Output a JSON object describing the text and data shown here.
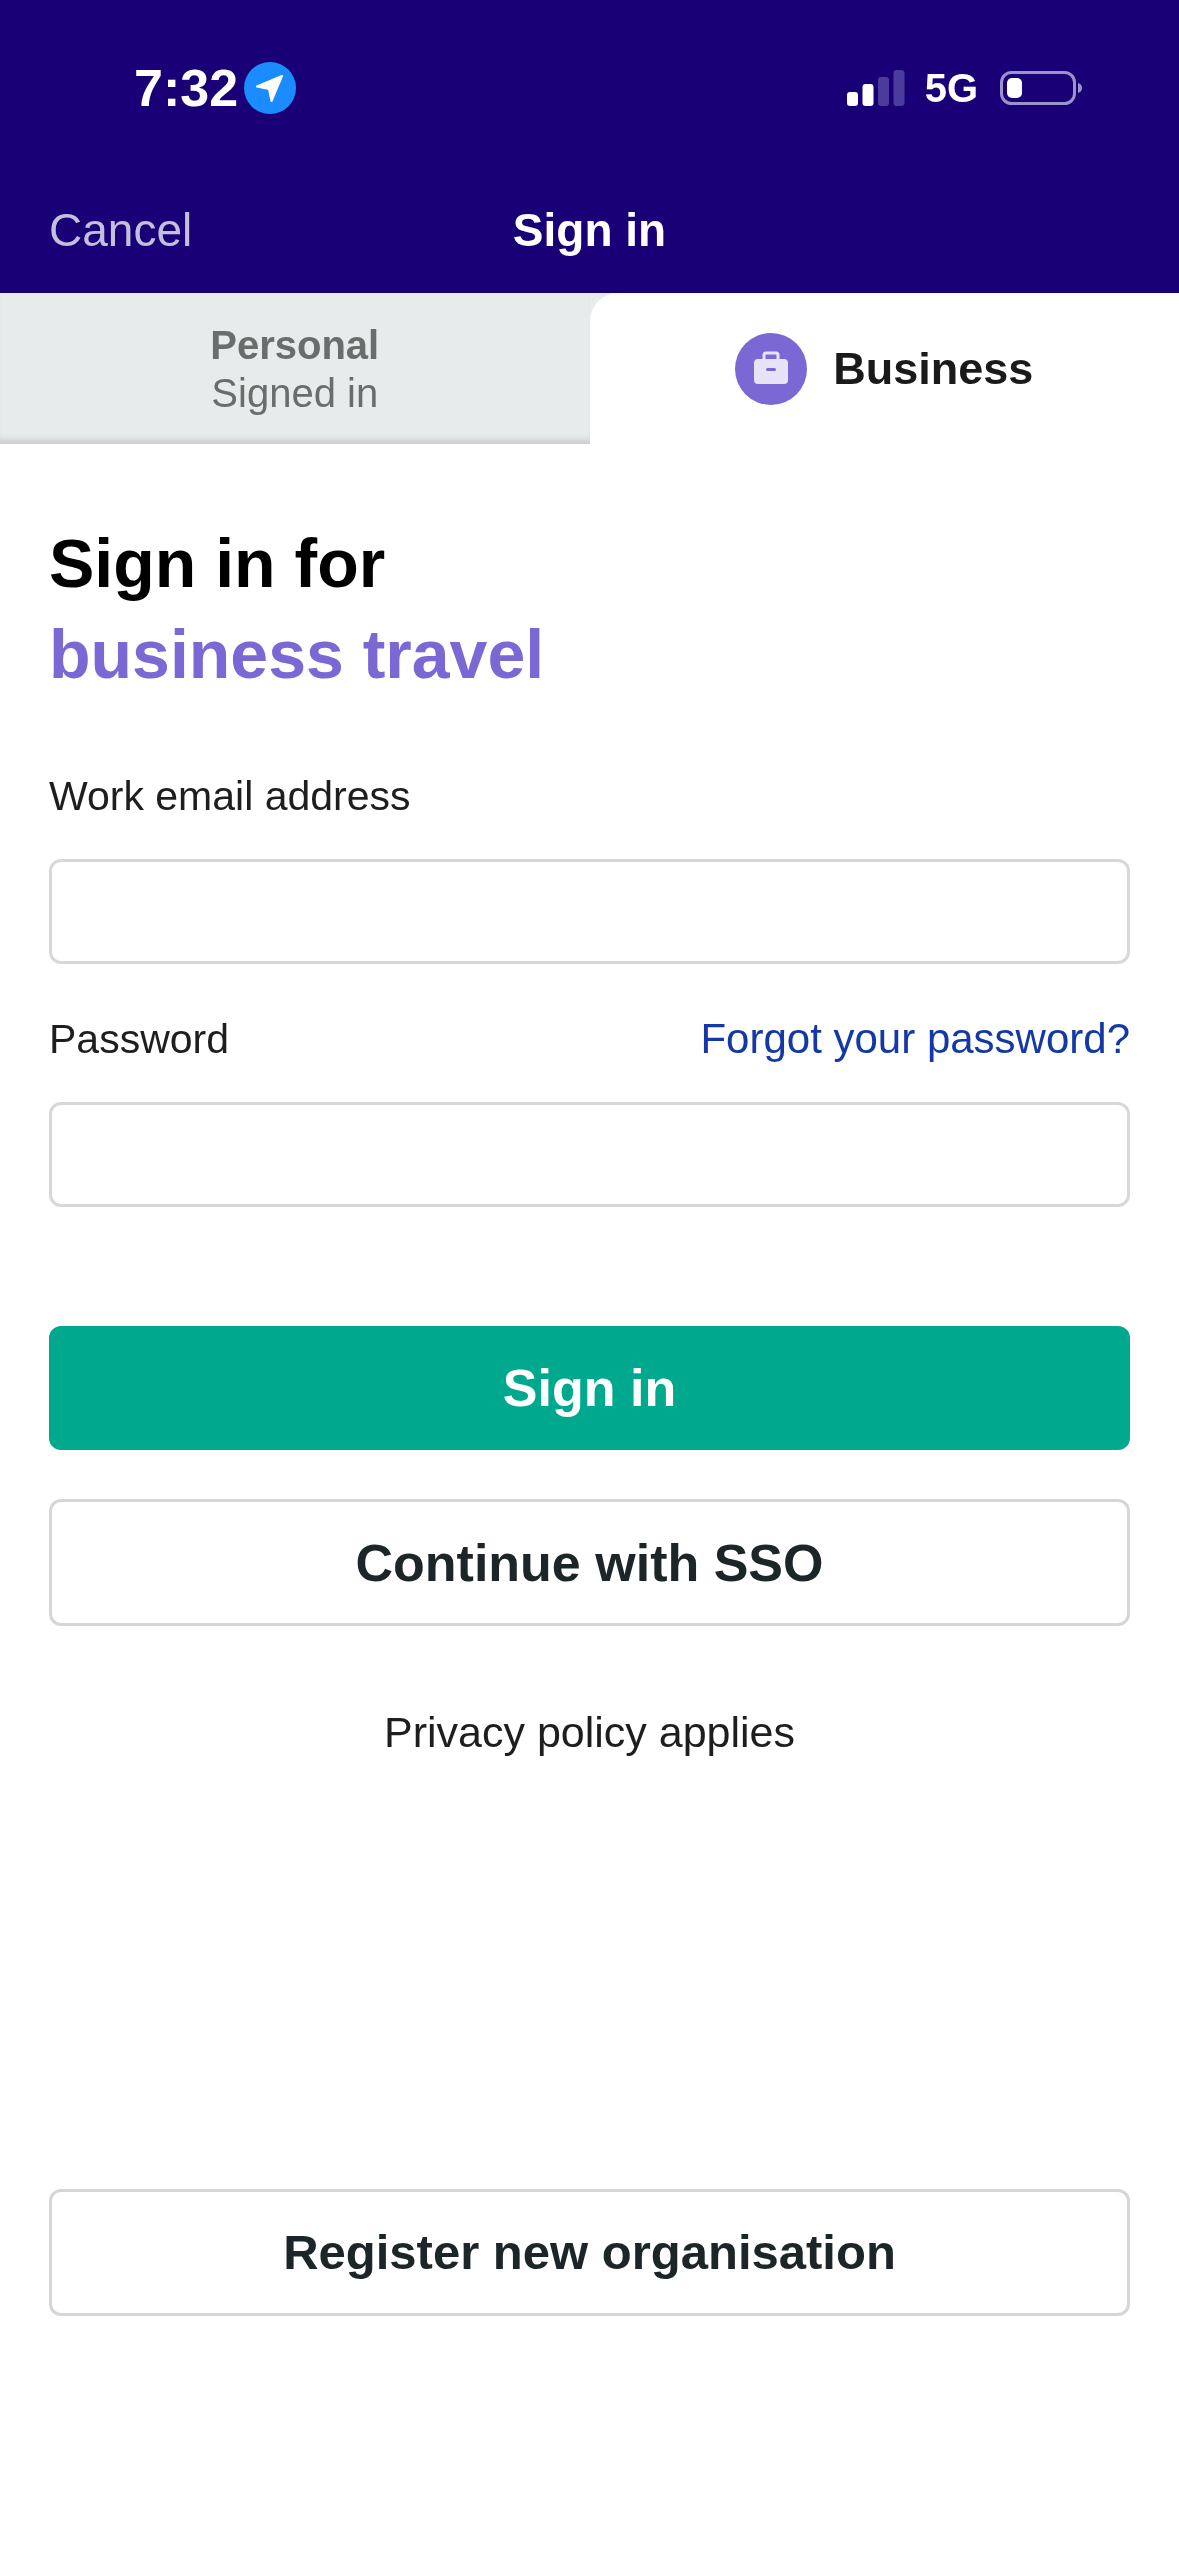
{
  "status_bar": {
    "time": "7:32",
    "network": "5G"
  },
  "nav_bar": {
    "cancel": "Cancel",
    "title": "Sign in"
  },
  "tabs": [
    {
      "label": "Personal",
      "sublabel": "Signed in",
      "kind": "text",
      "selected": false
    },
    {
      "label": "Business",
      "kind": "icon",
      "selected": true
    }
  ],
  "heading": {
    "line_1": "Sign in for",
    "line_2": "business travel"
  },
  "fields": [
    {
      "label": "Work email address"
    },
    {
      "label": "Password",
      "link": "Forgot your password?"
    }
  ],
  "buttons": [
    {
      "label": "Sign in",
      "kind": "primary"
    },
    {
      "label": "Continue with SSO",
      "kind": "secondary"
    }
  ],
  "privacy_note": "Privacy policy applies",
  "register_button": {
    "label": "Register new organisation",
    "kind": "secondary"
  }
}
